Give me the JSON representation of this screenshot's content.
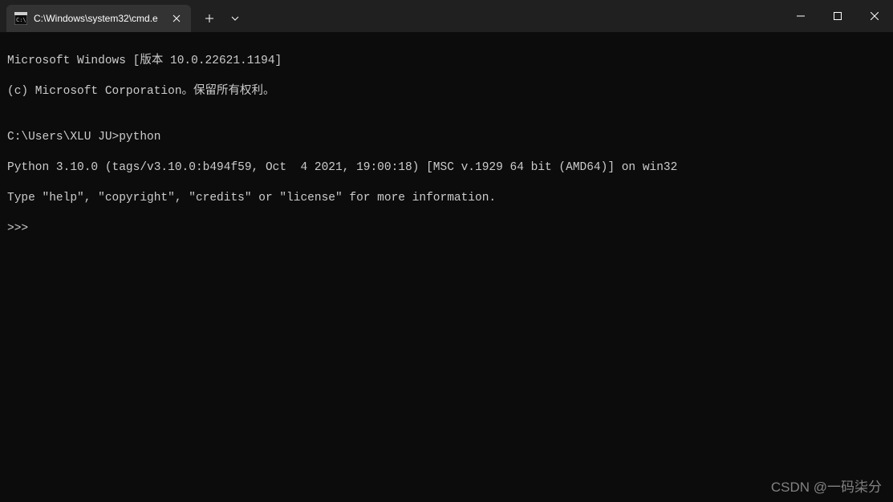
{
  "titlebar": {
    "tab": {
      "title": "C:\\Windows\\system32\\cmd.e"
    }
  },
  "terminal": {
    "line1": "Microsoft Windows [版本 10.0.22621.1194]",
    "line2": "(c) Microsoft Corporation。保留所有权利。",
    "blank1": "",
    "prompt_line": "C:\\Users\\XLU JU>python",
    "python_version": "Python 3.10.0 (tags/v3.10.0:b494f59, Oct  4 2021, 19:00:18) [MSC v.1929 64 bit (AMD64)] on win32",
    "python_help": "Type \"help\", \"copyright\", \"credits\" or \"license\" for more information.",
    "python_prompt": ">>> "
  },
  "watermark": "CSDN @一码柒分"
}
